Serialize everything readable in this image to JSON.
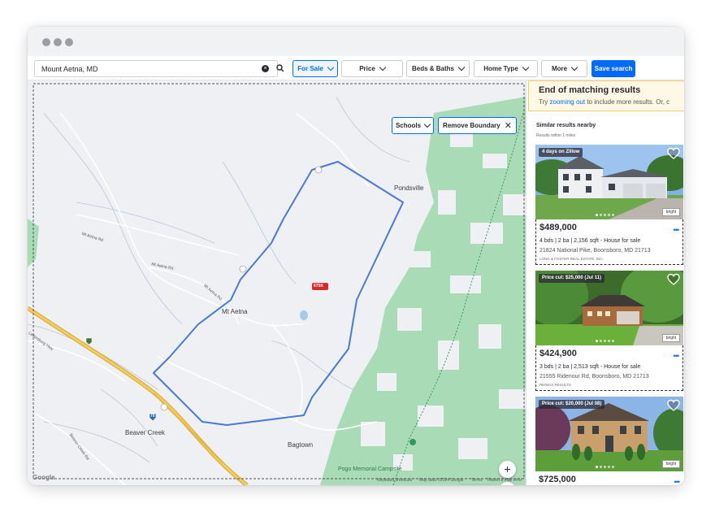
{
  "search": {
    "value": "Mount Aetna, MD"
  },
  "filters": {
    "for_sale": "For Sale",
    "price": "Price",
    "beds_baths": "Beds & Baths",
    "home_type": "Home Type",
    "more": "More",
    "save_search": "Save search"
  },
  "map": {
    "schools_button": "Schools",
    "remove_boundary_button": "Remove Boundary",
    "places": {
      "pondsville": "Pondsville",
      "mt_aetna": "Mt Aetna",
      "beaver_creek": "Beaver Creek",
      "bagtown": "Bagtown",
      "pogo": "Pogo Memorial Campsite"
    },
    "roads": {
      "mt_aetna_rd_1": "Mt Aetna Rd",
      "mt_aetna_rd_2": "Mt Aetna Rd",
      "mt_aetna_rd_3": "Mt Aetna Rd",
      "freedom_way": "Leitersburg Hwy",
      "frederick": "Beaver Creek Rd"
    },
    "route_badge": "675K",
    "interstate_label": "70",
    "map_type": "Map",
    "google": "Google",
    "attribution": {
      "keyboard": "Keyboard shortcuts",
      "mapdata": "Map data ©2024 Google",
      "terms": "Terms",
      "report": "Report a map error"
    }
  },
  "results": {
    "end_title": "End of matching results",
    "end_sub_pre": "Try",
    "end_sub_link": "zooming out",
    "end_sub_post": "to include more results. Or, c",
    "similar_title": "Similar results nearby",
    "similar_sub": "Results within 1 miles",
    "listings": [
      {
        "badge": "4 days on Zillow",
        "price": "$489,000",
        "facts": "4 bds | 2 ba | 2,156 sqft - House for sale",
        "address": "21824 National Pike, Boonsboro, MD 21713",
        "broker": "LONG & FOSTER REAL ESTATE, INC."
      },
      {
        "badge": "Price cut: $25,000 (Jul 11)",
        "price": "$424,900",
        "facts": "3 bds | 2 ba | 2,513 sqft - House for sale",
        "address": "21555 Ridenour Rd, Boonsboro, MD 21713",
        "broker": "RE/MAX RESULTS"
      },
      {
        "badge": "Price cut: $20,000 (Jul 08)",
        "price": "$725,000",
        "facts": "",
        "address": "",
        "broker": ""
      }
    ],
    "mls_label": "bright"
  },
  "colors": {
    "accent": "#006aff",
    "boundary": "#4a78d8",
    "forest": "#a8dab5",
    "interstate": "#e6b73b"
  }
}
